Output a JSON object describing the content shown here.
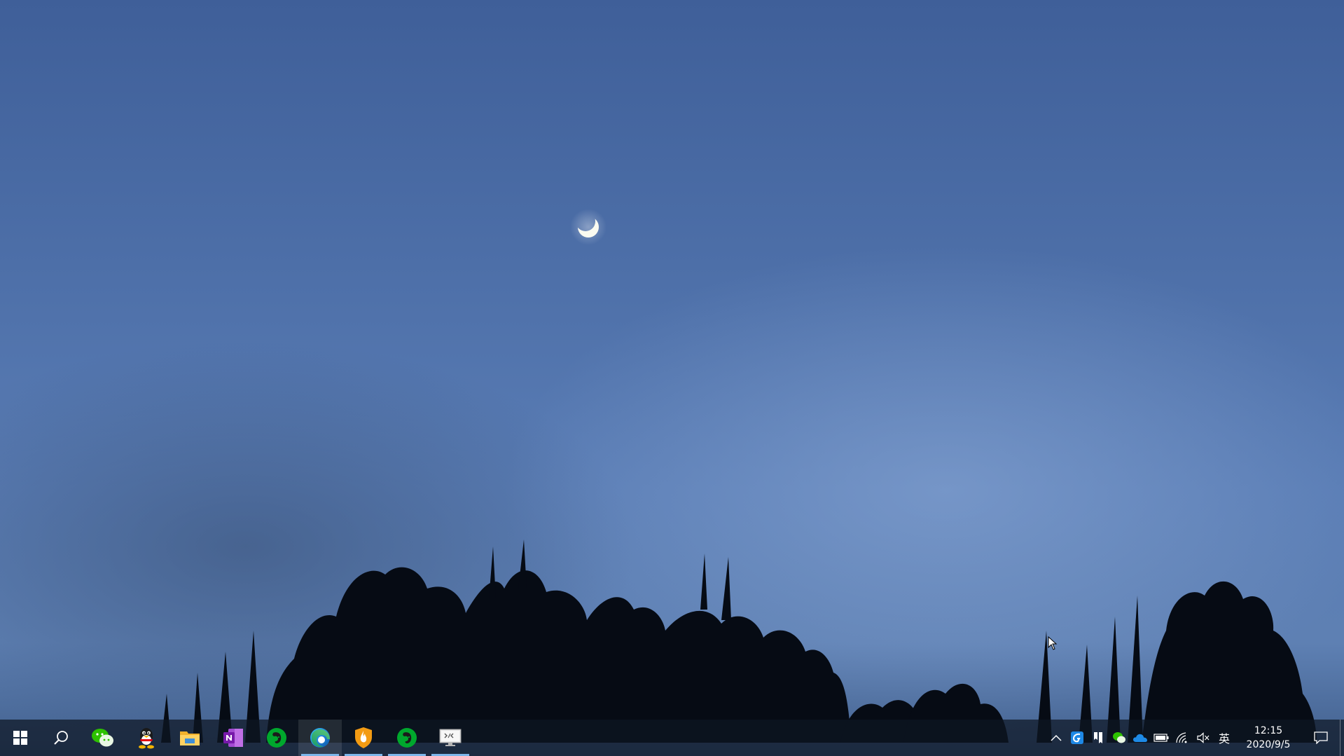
{
  "desktop": {
    "wallpaper": "night-sky-crescent-moon-tree-silhouettes"
  },
  "taskbar": {
    "start_icon": "windows-start-icon",
    "search_icon": "search-icon",
    "pinned_apps": [
      {
        "name": "WeChat",
        "icon": "wechat-icon",
        "running": false
      },
      {
        "name": "QQ",
        "icon": "qq-penguin-icon",
        "running": false
      },
      {
        "name": "File Explorer",
        "icon": "folder-icon",
        "running": false
      },
      {
        "name": "OneNote",
        "icon": "onenote-icon",
        "running": false
      },
      {
        "name": "Evernote",
        "icon": "evernote-icon",
        "running": false
      },
      {
        "name": "Microsoft Edge",
        "icon": "edge-icon",
        "running": true
      },
      {
        "name": "Huorong Security",
        "icon": "shield-icon",
        "running": true
      },
      {
        "name": "Evernote",
        "icon": "evernote-icon",
        "running": true
      },
      {
        "name": "Remote Display",
        "icon": "monitor-icon",
        "running": true
      }
    ],
    "accent_color": "#7cb6ea"
  },
  "tray": {
    "overflow_icon": "chevron-up-icon",
    "icons": [
      "browser-tray-icon",
      "bookmark-icon",
      "wechat-icon",
      "onedrive-icon",
      "battery-icon",
      "wifi-icon",
      "volume-muted-icon"
    ],
    "ime_label": "英",
    "clock": {
      "time": "12:15",
      "date": "2020/9/5"
    },
    "action_center_icon": "notification-icon"
  }
}
